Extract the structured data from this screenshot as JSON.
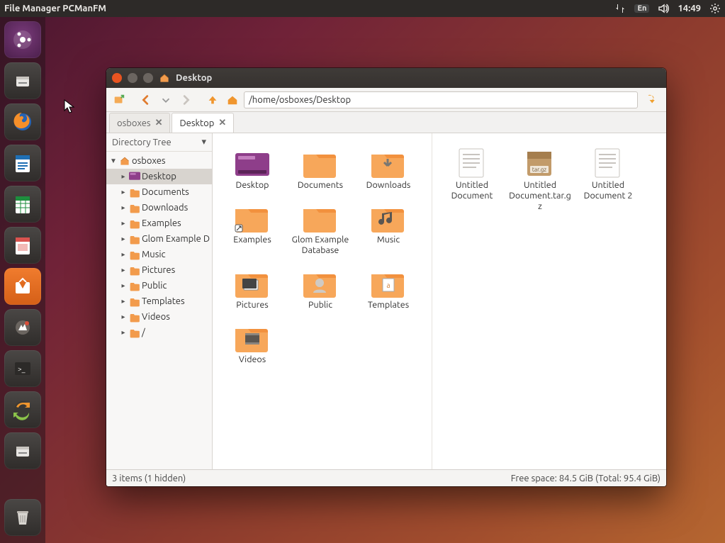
{
  "panel": {
    "app_title": "File Manager PCManFM",
    "lang": "En",
    "time": "14:49"
  },
  "launcher": {
    "items": [
      {
        "name": "dash",
        "kind": "ubuntu"
      },
      {
        "name": "files",
        "kind": "files"
      },
      {
        "name": "firefox",
        "kind": "firefox"
      },
      {
        "name": "writer",
        "kind": "writer"
      },
      {
        "name": "calc",
        "kind": "calc"
      },
      {
        "name": "impress",
        "kind": "impress"
      },
      {
        "name": "software",
        "kind": "software"
      },
      {
        "name": "settings",
        "kind": "settings"
      },
      {
        "name": "terminal",
        "kind": "terminal"
      },
      {
        "name": "updater",
        "kind": "updater"
      },
      {
        "name": "pcmanfm",
        "kind": "files"
      }
    ],
    "trash": "trash"
  },
  "fm": {
    "window_title": "Desktop",
    "path": "/home/osboxes/Desktop",
    "tabs": [
      {
        "label": "osboxes",
        "active": false
      },
      {
        "label": "Desktop",
        "active": true
      }
    ],
    "sidebar": {
      "header": "Directory Tree",
      "root": {
        "label": "osboxes",
        "expanded": true
      },
      "children": [
        {
          "label": "Desktop",
          "icon": "desktop",
          "selected": true
        },
        {
          "label": "Documents",
          "icon": "folder"
        },
        {
          "label": "Downloads",
          "icon": "folder"
        },
        {
          "label": "Examples",
          "icon": "folder"
        },
        {
          "label": "Glom Example D",
          "icon": "folder"
        },
        {
          "label": "Music",
          "icon": "folder"
        },
        {
          "label": "Pictures",
          "icon": "folder"
        },
        {
          "label": "Public",
          "icon": "folder"
        },
        {
          "label": "Templates",
          "icon": "folder"
        },
        {
          "label": "Videos",
          "icon": "folder"
        },
        {
          "label": "/",
          "icon": "folder"
        }
      ]
    },
    "left_panel": [
      {
        "label": "Desktop",
        "icon": "desktop"
      },
      {
        "label": "Documents",
        "icon": "folder"
      },
      {
        "label": "Downloads",
        "icon": "downloads"
      },
      {
        "label": "Examples",
        "icon": "folder-link"
      },
      {
        "label": "Glom Example Database",
        "icon": "folder"
      },
      {
        "label": "Music",
        "icon": "music"
      },
      {
        "label": "Pictures",
        "icon": "pictures"
      },
      {
        "label": "Public",
        "icon": "public"
      },
      {
        "label": "Templates",
        "icon": "templates"
      },
      {
        "label": "Videos",
        "icon": "videos"
      }
    ],
    "right_panel": [
      {
        "label": "Untitled Document",
        "icon": "text"
      },
      {
        "label": "Untitled Document.tar.gz",
        "icon": "archive"
      },
      {
        "label": "Untitled Document 2",
        "icon": "text"
      }
    ],
    "status_left": "3 items (1 hidden)",
    "status_right": "Free space: 84.5 GiB (Total: 95.4 GiB)"
  }
}
